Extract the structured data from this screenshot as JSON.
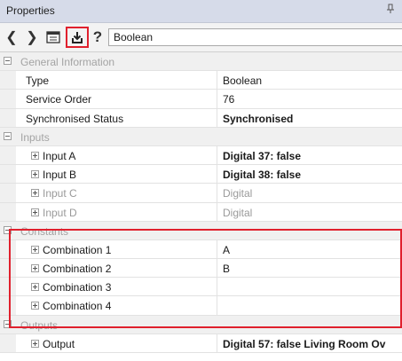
{
  "panel": {
    "title": "Properties",
    "pin_glyph": "p"
  },
  "toolbar": {
    "back_glyph": "❮",
    "forward_glyph": "❯",
    "help_glyph": "?",
    "type_value": "Boolean"
  },
  "categories": {
    "general": "General Information",
    "inputs": "Inputs",
    "constants": "Constants",
    "outputs": "Outputs"
  },
  "general": [
    {
      "name": "Type",
      "value": "Boolean"
    },
    {
      "name": "Service Order",
      "value": "76"
    },
    {
      "name": "Synchronised Status",
      "value": "Synchronised"
    }
  ],
  "inputs": [
    {
      "name": "Input A",
      "value": "Digital 37: false"
    },
    {
      "name": "Input B",
      "value": "Digital 38: false"
    },
    {
      "name": "Input C",
      "value": "Digital"
    },
    {
      "name": "Input D",
      "value": "Digital"
    }
  ],
  "constants": [
    {
      "name": "Combination 1",
      "value": "A"
    },
    {
      "name": "Combination 2",
      "value": "B"
    },
    {
      "name": "Combination 3",
      "value": ""
    },
    {
      "name": "Combination 4",
      "value": ""
    }
  ],
  "outputs": [
    {
      "name": "Output",
      "value": "Digital 57: false Living Room Ov"
    }
  ],
  "colors": {
    "highlight": "#e0202d",
    "category_bg": "#f0f0f0"
  }
}
